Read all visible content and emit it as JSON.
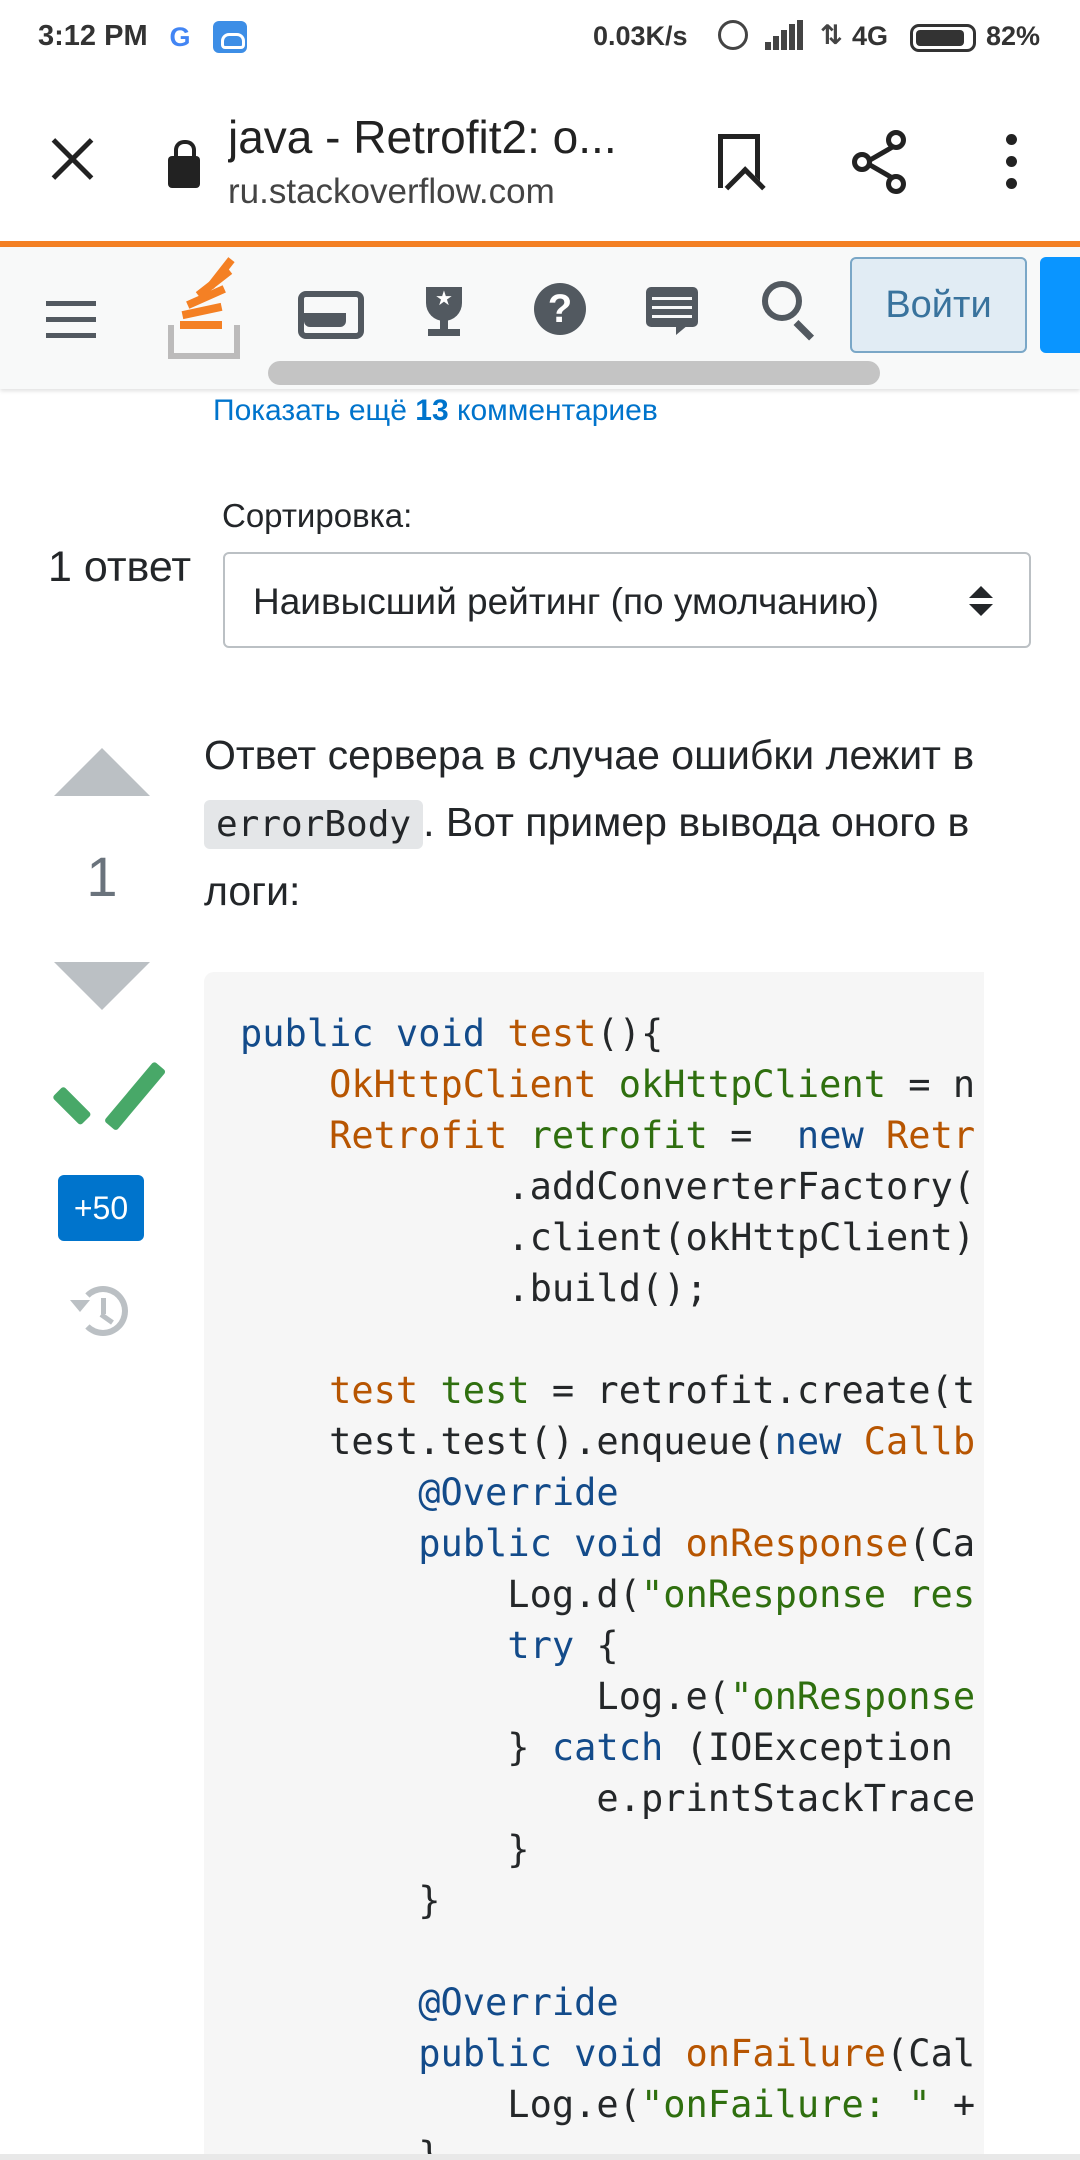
{
  "status_bar": {
    "time": "3:12 PM",
    "google_icon": "G",
    "net_speed": "0.03K/s",
    "network": "4G",
    "battery": "82%"
  },
  "browser": {
    "page_title": "java - Retrofit2: о...",
    "domain": "ru.stackoverflow.com"
  },
  "so_topbar": {
    "help_icon": "?",
    "login_label": "Войти"
  },
  "comments": {
    "prefix": "Показать ещё ",
    "count": "13",
    "suffix": " комментариев"
  },
  "sort": {
    "label": "Сортировка:",
    "selected": "Наивысший рейтинг (по умолчанию)"
  },
  "answers_count": "1 ответ",
  "answer": {
    "votes": "1",
    "bounty": "+50",
    "text_part1": "Ответ сервера в случае ошибки лежит в ",
    "inline_code": "errorBody",
    "text_part2": ". Вот пример вывода оного в логи:"
  },
  "code_lines": [
    [
      [
        "k",
        "public void "
      ],
      [
        "t",
        "test"
      ],
      [
        "",
        "(){"
      ]
    ],
    [
      [
        "",
        "    "
      ],
      [
        "t",
        "OkHttpClient "
      ],
      [
        "v",
        "okHttpClient"
      ],
      [
        "",
        " = n"
      ]
    ],
    [
      [
        "",
        "    "
      ],
      [
        "t",
        "Retrofit "
      ],
      [
        "v",
        "retrofit"
      ],
      [
        "",
        " =  "
      ],
      [
        "k",
        "new "
      ],
      [
        "t",
        "Retr"
      ]
    ],
    [
      [
        "",
        "            .addConverterFactory("
      ]
    ],
    [
      [
        "",
        "            .client(okHttpClient)"
      ]
    ],
    [
      [
        "",
        "            .build();"
      ]
    ],
    [
      [
        "",
        ""
      ]
    ],
    [
      [
        "",
        "    "
      ],
      [
        "t",
        "test "
      ],
      [
        "v",
        "test"
      ],
      [
        "",
        " = retrofit.create(t"
      ]
    ],
    [
      [
        "",
        "    test.test().enqueue("
      ],
      [
        "k",
        "new "
      ],
      [
        "t",
        "Callb"
      ]
    ],
    [
      [
        "",
        "        "
      ],
      [
        "k",
        "@Override"
      ]
    ],
    [
      [
        "",
        "        "
      ],
      [
        "k",
        "public void "
      ],
      [
        "t",
        "onResponse"
      ],
      [
        "",
        "(Ca"
      ]
    ],
    [
      [
        "",
        "            Log.d("
      ],
      [
        "s",
        "\"onResponse res"
      ]
    ],
    [
      [
        "",
        "            "
      ],
      [
        "k",
        "try"
      ],
      [
        "",
        " {"
      ]
    ],
    [
      [
        "",
        "                Log.e("
      ],
      [
        "s",
        "\"onResponse"
      ]
    ],
    [
      [
        "",
        "            } "
      ],
      [
        "k",
        "catch"
      ],
      [
        "",
        " (IOException "
      ]
    ],
    [
      [
        "",
        "                e.printStackTrace"
      ]
    ],
    [
      [
        "",
        "            }"
      ]
    ],
    [
      [
        "",
        "        }"
      ]
    ],
    [
      [
        "",
        ""
      ]
    ],
    [
      [
        "",
        "        "
      ],
      [
        "k",
        "@Override"
      ]
    ],
    [
      [
        "",
        "        "
      ],
      [
        "k",
        "public void "
      ],
      [
        "t",
        "onFailure"
      ],
      [
        "",
        "(Cal"
      ]
    ],
    [
      [
        "",
        "            Log.e("
      ],
      [
        "s",
        "\"onFailure: \""
      ],
      [
        "",
        " +"
      ]
    ],
    [
      [
        "",
        "        }"
      ]
    ]
  ]
}
